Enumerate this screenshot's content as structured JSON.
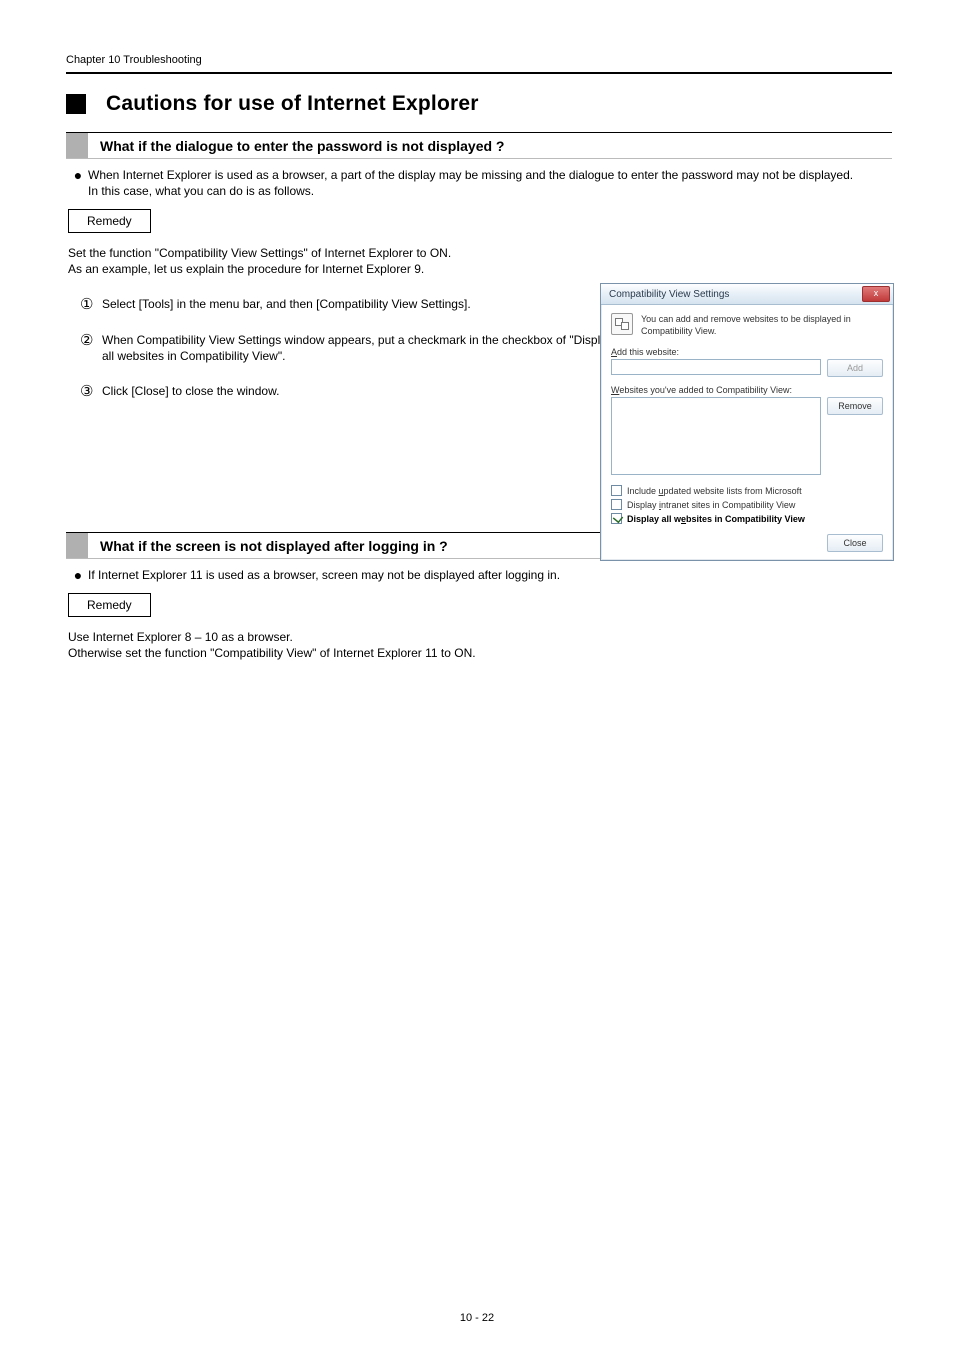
{
  "header": {
    "chapter": "Chapter 10 Troubleshooting"
  },
  "section": {
    "title": "Cautions for use of Internet Explorer"
  },
  "sub1": {
    "title": "What if the dialogue to enter the password is not displayed ?",
    "note": "When Internet Explorer is used as a browser, a part of the display may be missing and the dialogue to enter the password may not be displayed.\nIn this case, what you can do is as follows.",
    "remedy_label": "Remedy",
    "remedy_intro": "Set the function \"Compatibility View Settings\" of Internet Explorer to ON.\nAs an example, let us explain the procedure for Internet Explorer 9.",
    "steps": [
      "Select [Tools] in the menu bar, and then [Compatibility View Settings].",
      "When Compatibility View Settings window appears, put a checkmark in the checkbox of \"Display all websites in Compatibility View\".",
      "Click [Close] to close the window."
    ]
  },
  "dialog": {
    "title": "Compatibility View Settings",
    "close_glyph": "x",
    "info": "You can add and remove websites to be displayed in Compatibility View.",
    "add_label_rest": "dd this website:",
    "list_label_rest": "ebsites you've added to Compatibility View:",
    "remove_rest": "emove",
    "cb1_pre": "Include ",
    "cb1_post": "pdated website lists from Microsoft",
    "cb2_pre": "Display ",
    "cb2_post": "ntranet sites in Compatibility View",
    "cb3_pre": "Display all w",
    "cb3_post": "bsites in Compatibility View",
    "close_rest": "lose"
  },
  "sub2": {
    "title": "What if the screen is not displayed after logging in ?",
    "note": "If Internet Explorer 11 is used as a browser, screen may not be displayed after logging in.",
    "remedy_label": "Remedy",
    "remedy_body": "Use Internet Explorer 8 – 10 as a browser.\nOtherwise set the function \"Compatibility View\" of Internet Explorer 11 to ON."
  },
  "footer": {
    "page": "10 - 22"
  }
}
